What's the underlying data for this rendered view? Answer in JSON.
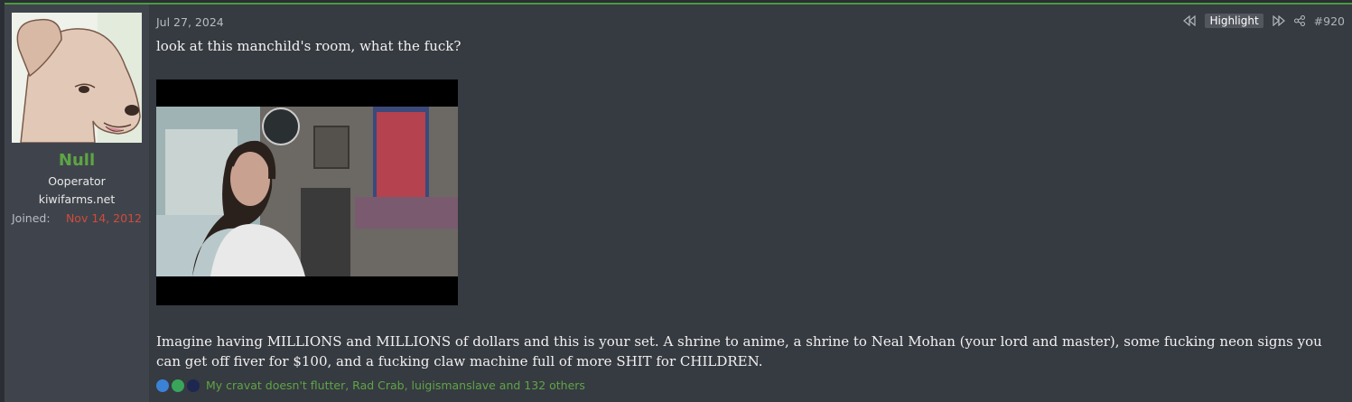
{
  "user": {
    "name": "Null",
    "title": "Ooperator",
    "site": "kiwifarms.net",
    "joined_label": "Joined:",
    "joined_date": "Nov 14, 2012"
  },
  "post": {
    "date": "Jul 27, 2024",
    "highlight_label": "Highlight",
    "post_number": "#920",
    "line1": "look at this manchild's room, what the fuck?",
    "paragraph": "Imagine having MILLIONS and MILLIONS of dollars and this is your set. A shrine to anime, a shrine to Neal Mohan (your lord and master), some fucking neon signs you can get off fiver for $100, and a fucking claw machine full of more SHIT for CHILDREN."
  },
  "reactions": {
    "text": "My cravat doesn't flutter, Rad Crab, luigismanslave and 132 others",
    "icons": [
      "thumbs-up-icon",
      "checkmark-icon",
      "top-hat-icon"
    ]
  },
  "colors": {
    "accent_green": "#5ea545",
    "joined_red": "#d24a3b",
    "post_bg": "#363a41",
    "sidebar_bg": "#3f444c"
  }
}
